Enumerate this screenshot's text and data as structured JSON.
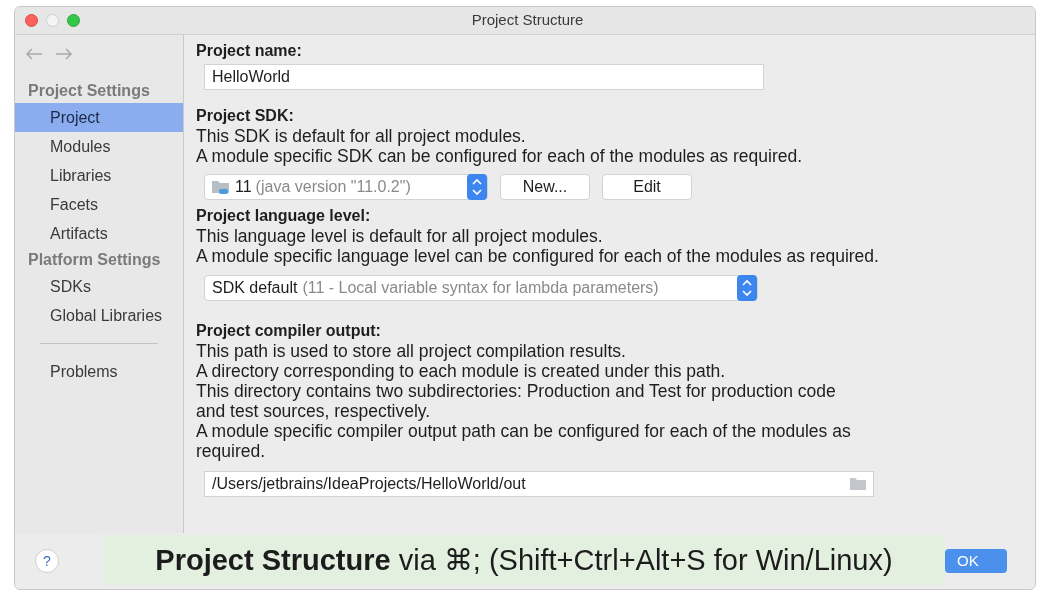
{
  "window": {
    "title": "Project Structure"
  },
  "sidebar": {
    "sections": [
      {
        "title": "Project Settings",
        "items": [
          {
            "label": "Project",
            "selected": true
          },
          {
            "label": "Modules",
            "selected": false
          },
          {
            "label": "Libraries",
            "selected": false
          },
          {
            "label": "Facets",
            "selected": false
          },
          {
            "label": "Artifacts",
            "selected": false
          }
        ]
      },
      {
        "title": "Platform Settings",
        "items": [
          {
            "label": "SDKs",
            "selected": false
          },
          {
            "label": "Global Libraries",
            "selected": false
          }
        ]
      }
    ],
    "bottom_items": [
      {
        "label": "Problems",
        "selected": false
      }
    ]
  },
  "project_name": {
    "label": "Project name:",
    "value": "HelloWorld"
  },
  "project_sdk": {
    "label": "Project SDK:",
    "description": [
      "This SDK is default for all project modules.",
      "A module specific SDK can be configured for each of the modules as required."
    ],
    "select": {
      "value": "11",
      "hint": "(java version \"11.0.2\")"
    },
    "buttons": [
      "New...",
      "Edit"
    ]
  },
  "language_level": {
    "label": "Project language level:",
    "description": [
      "This language level is default for all project modules.",
      "A module specific language level can be configured for each of the modules as required."
    ],
    "select": {
      "value": "SDK default",
      "hint": "(11 - Local variable syntax for lambda parameters)"
    }
  },
  "compiler_output": {
    "label": "Project compiler output:",
    "description": [
      "This path is used to store all project compilation results.",
      "A directory corresponding to each module is created under this path.",
      "This directory contains two subdirectories: Production and Test for production code and test sources, respectively.",
      "A module specific compiler output path can be configured for each of the modules as required."
    ],
    "value": "/Users/jetbrains/IdeaProjects/HelloWorld/out"
  },
  "footer": {
    "help": "?",
    "ok": "OK"
  },
  "caption": "**Project Structure** via ⌘; (Shift+Ctrl+Alt+S for Win/Linux)"
}
